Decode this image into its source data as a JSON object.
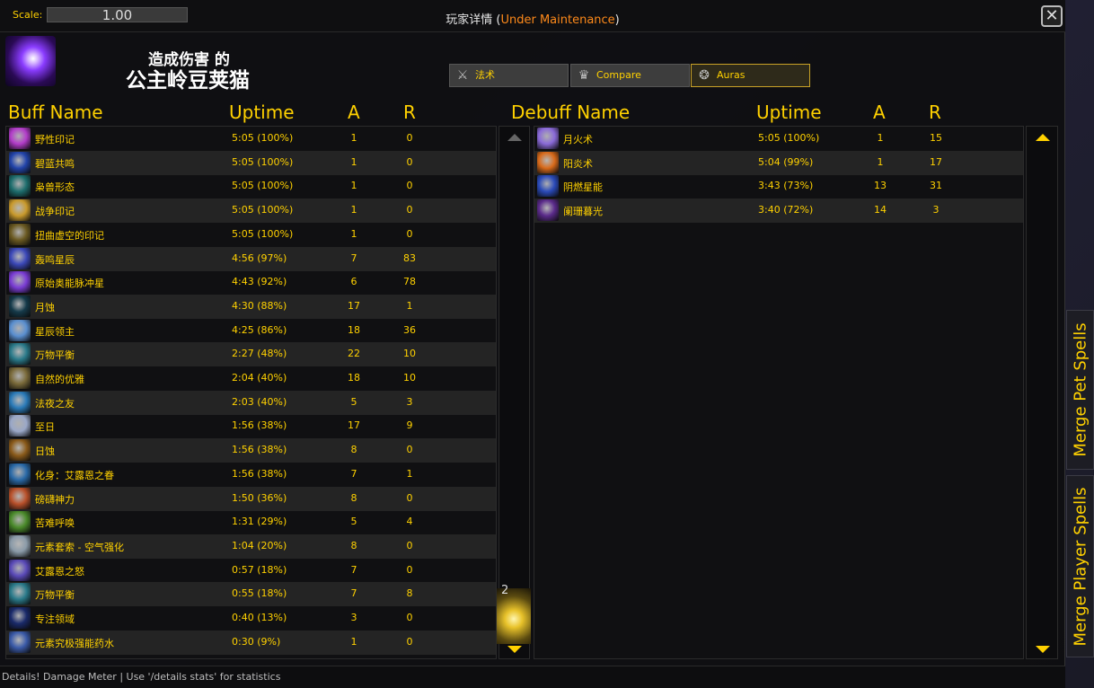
{
  "titlebar": {
    "scale_label": "Scale:",
    "scale_value": "1.00",
    "title_main": "玩家详情 (",
    "title_status": "Under Maintenance",
    "title_end": ")",
    "close_glyph": "✕"
  },
  "player": {
    "damage_by": "造成伤害 的",
    "name": "公主岭豆荚猫",
    "spec_icon": "balance-druid-icon"
  },
  "tabs": [
    {
      "label": "法术",
      "icon": "swords-icon",
      "active": false
    },
    {
      "label": "Compare",
      "icon": "crown-icon",
      "active": false
    },
    {
      "label": "Auras",
      "icon": "swirl-icon",
      "active": true
    }
  ],
  "buffs": {
    "headers": {
      "name": "Buff Name",
      "uptime": "Uptime",
      "a": "A",
      "r": "R"
    },
    "rows": [
      {
        "name": "野性印记",
        "uptime": "5:05 (100%)",
        "a": "1",
        "r": "0",
        "color": "#b23cc9"
      },
      {
        "name": "碧蓝共鸣",
        "uptime": "5:05 (100%)",
        "a": "1",
        "r": "0",
        "color": "#2244aa"
      },
      {
        "name": "枭兽形态",
        "uptime": "5:05 (100%)",
        "a": "1",
        "r": "0",
        "color": "#1d6d6d"
      },
      {
        "name": "战争印记",
        "uptime": "5:05 (100%)",
        "a": "1",
        "r": "0",
        "color": "#c99a2c"
      },
      {
        "name": "扭曲虚空的印记",
        "uptime": "5:05 (100%)",
        "a": "1",
        "r": "0",
        "color": "#6b5a22"
      },
      {
        "name": "轰鸣星辰",
        "uptime": "4:56 (97%)",
        "a": "7",
        "r": "83",
        "color": "#3b48b8"
      },
      {
        "name": "原始奥能脉冲星",
        "uptime": "4:43 (92%)",
        "a": "6",
        "r": "78",
        "color": "#7a3cd4"
      },
      {
        "name": "月蚀",
        "uptime": "4:30 (88%)",
        "a": "17",
        "r": "1",
        "color": "#153a4a"
      },
      {
        "name": "星辰领主",
        "uptime": "4:25 (86%)",
        "a": "18",
        "r": "36",
        "color": "#5a8fd0"
      },
      {
        "name": "万物平衡",
        "uptime": "2:27 (48%)",
        "a": "22",
        "r": "10",
        "color": "#2a7a8a"
      },
      {
        "name": "自然的优雅",
        "uptime": "2:04 (40%)",
        "a": "18",
        "r": "10",
        "color": "#7a6a3a"
      },
      {
        "name": "法夜之友",
        "uptime": "2:03 (40%)",
        "a": "5",
        "r": "3",
        "color": "#2a7ab8"
      },
      {
        "name": "至日",
        "uptime": "1:56 (38%)",
        "a": "17",
        "r": "9",
        "color": "#9aa8c8"
      },
      {
        "name": "日蚀",
        "uptime": "1:56 (38%)",
        "a": "8",
        "r": "0",
        "color": "#8a5a1a"
      },
      {
        "name": "化身：艾露恩之眷",
        "uptime": "1:56 (38%)",
        "a": "7",
        "r": "1",
        "color": "#2a6aa8"
      },
      {
        "name": "磅礴神力",
        "uptime": "1:50 (36%)",
        "a": "8",
        "r": "0",
        "color": "#b8502a"
      },
      {
        "name": "苦难呼唤",
        "uptime": "1:31 (29%)",
        "a": "5",
        "r": "4",
        "color": "#4a8a2a"
      },
      {
        "name": "元素套索 - 空气强化",
        "uptime": "1:04 (20%)",
        "a": "8",
        "r": "0",
        "color": "#8a9aa8"
      },
      {
        "name": "艾露恩之怒",
        "uptime": "0:57 (18%)",
        "a": "7",
        "r": "0",
        "color": "#5a4ab8"
      },
      {
        "name": "万物平衡",
        "uptime": "0:55 (18%)",
        "a": "7",
        "r": "8",
        "color": "#2a7a8a"
      },
      {
        "name": "专注领域",
        "uptime": "0:40 (13%)",
        "a": "3",
        "r": "0",
        "color": "#1a2a6a"
      },
      {
        "name": "元素究极强能药水",
        "uptime": "0:30 (9%)",
        "a": "1",
        "r": "0",
        "color": "#3a5aa8"
      }
    ]
  },
  "debuffs": {
    "headers": {
      "name": "Debuff Name",
      "uptime": "Uptime",
      "a": "A",
      "r": "R"
    },
    "rows": [
      {
        "name": "月火术",
        "uptime": "5:05 (100%)",
        "a": "1",
        "r": "15",
        "color": "#8a6ad8"
      },
      {
        "name": "阳炎术",
        "uptime": "5:04 (99%)",
        "a": "1",
        "r": "17",
        "color": "#d86a1a"
      },
      {
        "name": "阴燃星能",
        "uptime": "3:43 (73%)",
        "a": "13",
        "r": "31",
        "color": "#2a4ab8"
      },
      {
        "name": "阑珊暮光",
        "uptime": "3:40 (72%)",
        "a": "14",
        "r": "3",
        "color": "#5a2a8a"
      }
    ]
  },
  "side_tabs": {
    "pet": "Merge Pet Spells",
    "player": "Merge Player Spells"
  },
  "thumb_number": "2",
  "status": "Details! Damage Meter | Use '/details stats' for statistics"
}
